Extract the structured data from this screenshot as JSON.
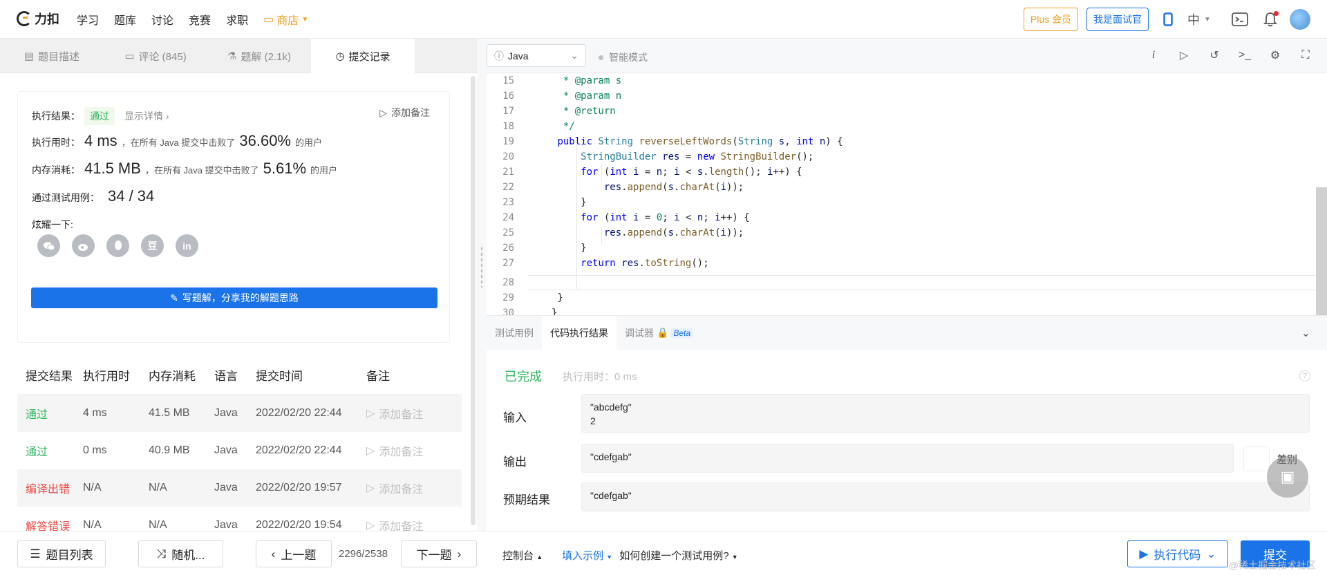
{
  "nav": {
    "logo_text": "力扣",
    "items": [
      "学习",
      "题库",
      "讨论",
      "竞赛",
      "求职"
    ],
    "shop": "商店",
    "plus_member": "Plus 会员",
    "interviewer": "我是面试官",
    "lang": "中"
  },
  "left_tabs": [
    {
      "label": "题目描述",
      "icon": "description-icon"
    },
    {
      "label": "评论 (845)",
      "icon": "comment-icon"
    },
    {
      "label": "题解 (2.1k)",
      "icon": "flask-icon"
    },
    {
      "label": "提交记录",
      "icon": "clock-icon"
    }
  ],
  "result": {
    "label_result": "执行结果：",
    "status": "通过",
    "show_details": "显示详情",
    "add_note": "添加备注",
    "label_time": "执行用时：",
    "time_value": "4 ms",
    "time_mid": "，在所有 Java 提交中击败了",
    "time_pct": "36.60%",
    "users_suffix": "的用户",
    "label_mem": "内存消耗：",
    "mem_value": "41.5 MB",
    "mem_mid": "，在所有 Java 提交中击败了",
    "mem_pct": "5.61%",
    "label_tests": "通过测试用例：",
    "tests_value": "34  /  34",
    "label_share": "炫耀一下:",
    "share_icons": [
      "wechat-icon",
      "weibo-icon",
      "qq-icon",
      "douban-icon",
      "linkedin-icon"
    ],
    "douban_glyph": "豆",
    "linkedin_glyph": "in",
    "write_solution": "写题解，分享我的解题思路"
  },
  "submissions": {
    "headers": [
      "提交结果",
      "执行用时",
      "内存消耗",
      "语言",
      "提交时间",
      "备注"
    ],
    "rows": [
      {
        "status": "通过",
        "time": "4 ms",
        "memory": "41.5 MB",
        "lang": "Java",
        "date": "2022/02/20 22:44",
        "note": "添加备注"
      },
      {
        "status": "通过",
        "time": "0 ms",
        "memory": "40.9 MB",
        "lang": "Java",
        "date": "2022/02/20 22:44",
        "note": "添加备注"
      },
      {
        "status": "编译出错",
        "time": "N/A",
        "memory": "N/A",
        "lang": "Java",
        "date": "2022/02/20 19:57",
        "note": "添加备注"
      },
      {
        "status": "解答错误",
        "time": "N/A",
        "memory": "N/A",
        "lang": "Java",
        "date": "2022/02/20 19:54",
        "note": "添加备注"
      }
    ]
  },
  "editor": {
    "language": "Java",
    "smart_mode": "智能模式",
    "line_numbers": [
      "15",
      "16",
      "17",
      "18",
      "19",
      "20",
      "21",
      "22",
      "23",
      "24",
      "25",
      "26",
      "27",
      "28",
      "29",
      "30"
    ]
  },
  "bottom_tabs": {
    "test_case": "测试用例",
    "exec_result": "代码执行结果",
    "debugger": "调试器",
    "beta": "Beta"
  },
  "exec": {
    "done": "已完成",
    "exec_time": "执行用时：0 ms",
    "input_label": "输入",
    "input_line1": "\"abcdefg\"",
    "input_line2": "2",
    "output_label": "输出",
    "output_value": "\"cdefgab\"",
    "diff_label": "差别",
    "expected_label": "预期结果",
    "expected_value": "\"cdefgab\""
  },
  "footer": {
    "problem_list": "题目列表",
    "random": "随机...",
    "prev": "上一题",
    "page": "2296/2538",
    "next": "下一题",
    "console": "控制台",
    "fill_example": "填入示例",
    "how_create": "如何创建一个测试用例?",
    "run_code": "执行代码",
    "submit": "提交",
    "watermark": "@稀土掘金技术社区"
  }
}
